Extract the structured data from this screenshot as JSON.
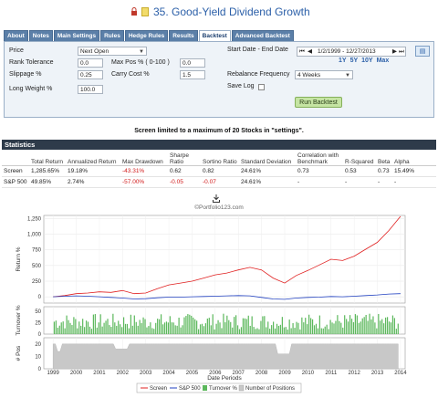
{
  "header": {
    "title": "35. Good-Yield Dividend Growth",
    "icons": [
      "lock-icon",
      "note-icon"
    ],
    "colors": {
      "title": "#2b5fa8",
      "lock": "#c0392b"
    }
  },
  "tabs": [
    {
      "label": "About",
      "active": false
    },
    {
      "label": "Notes",
      "active": false
    },
    {
      "label": "Main Settings",
      "active": false
    },
    {
      "label": "Rules",
      "active": false
    },
    {
      "label": "Hedge Rules",
      "active": false
    },
    {
      "label": "Results",
      "active": false
    },
    {
      "label": "Backtest",
      "active": true
    },
    {
      "label": "Advanced Backtest",
      "active": false
    }
  ],
  "form": {
    "price_label": "Price",
    "price_value": "Next Open",
    "rank_tolerance_label": "Rank Tolerance",
    "rank_tolerance_value": "0.0",
    "max_pos_label": "Max Pos % ( 0-100 )",
    "max_pos_value": "0.0",
    "slippage_label": "Slippage %",
    "slippage_value": "0.25",
    "carry_cost_label": "Carry Cost %",
    "carry_cost_value": "1.5",
    "long_weight_label": "Long Weight %",
    "long_weight_value": "100.0",
    "date_range_label": "Start Date - End Date",
    "date_range_value": "1/2/1999 - 12/27/2013",
    "periods": [
      "1Y",
      "5Y",
      "10Y",
      "Max"
    ],
    "rebalance_label": "Rebalance Frequency",
    "rebalance_value": "4 Weeks",
    "save_log_label": "Save Log",
    "save_log_checked": false,
    "run_button": "Run Backtest"
  },
  "notice": "Screen limited to a maximum of 20 Stocks in \"settings\".",
  "stats": {
    "heading": "Statistics",
    "columns": [
      "",
      "Total Return",
      "Annualized Return",
      "Max Drawdown",
      "Sharpe Ratio",
      "Sortino Ratio",
      "Standard Deviation",
      "Correlation with Benchmark",
      "R-Squared",
      "Beta",
      "Alpha"
    ],
    "rows": [
      [
        "Screen",
        "1,285.65%",
        "19.18%",
        "-43.31%",
        "0.62",
        "0.82",
        "24.61%",
        "0.73",
        "0.53",
        "0.73",
        "15.49%"
      ],
      [
        "S&P 500",
        "49.85%",
        "2.74%",
        "-57.00%",
        "-0.05",
        "-0.07",
        "24.61%",
        "-",
        "-",
        "-",
        "-"
      ]
    ]
  },
  "watermark": "©Portfolio123.com",
  "chart_data": {
    "type": "line",
    "title": "",
    "xlabel": "Date Periods",
    "ylabel": "Return %",
    "x_ticks": [
      "1999",
      "2000",
      "2001",
      "2002",
      "2003",
      "2004",
      "2005",
      "2006",
      "2007",
      "2008",
      "2009",
      "2010",
      "2011",
      "2012",
      "2013",
      "2014"
    ],
    "y_ticks": [
      "0",
      "250",
      "500",
      "750",
      "1,000",
      "1,250"
    ],
    "ylim": [
      -100,
      1300
    ],
    "series": [
      {
        "name": "Screen",
        "color": "#e02020",
        "x": [
          1999,
          1999.5,
          2000,
          2000.5,
          2001,
          2001.5,
          2002,
          2002.5,
          2003,
          2003.5,
          2004,
          2004.5,
          2005,
          2005.5,
          2006,
          2006.5,
          2007,
          2007.5,
          2008,
          2008.5,
          2009,
          2009.5,
          2010,
          2010.5,
          2011,
          2011.5,
          2012,
          2012.5,
          2013,
          2013.5,
          2014
        ],
        "values": [
          0,
          20,
          50,
          60,
          80,
          70,
          100,
          50,
          60,
          130,
          190,
          220,
          250,
          300,
          350,
          380,
          430,
          470,
          430,
          300,
          220,
          340,
          420,
          510,
          600,
          580,
          650,
          760,
          870,
          1060,
          1285
        ]
      },
      {
        "name": "S&P 500",
        "color": "#2040c0",
        "x": [
          1999,
          1999.5,
          2000,
          2000.5,
          2001,
          2001.5,
          2002,
          2002.5,
          2003,
          2003.5,
          2004,
          2004.5,
          2005,
          2005.5,
          2006,
          2006.5,
          2007,
          2007.5,
          2008,
          2008.5,
          2009,
          2009.5,
          2010,
          2010.5,
          2011,
          2011.5,
          2012,
          2012.5,
          2013,
          2013.5,
          2014
        ],
        "values": [
          0,
          10,
          15,
          10,
          0,
          -10,
          -20,
          -35,
          -30,
          -15,
          -5,
          -5,
          0,
          5,
          10,
          15,
          20,
          15,
          -10,
          -35,
          -40,
          -20,
          -10,
          -5,
          5,
          0,
          10,
          20,
          30,
          45,
          50
        ]
      }
    ],
    "turnover": {
      "name": "Turnover %",
      "color": "#5cb85c",
      "ylabel": "Turnover %",
      "y_ticks": [
        "0",
        "25",
        "50"
      ],
      "ylim": [
        0,
        60
      ]
    },
    "positions": {
      "name": "Number of Positions",
      "color": "#c8c8c8",
      "ylabel": "# Pos",
      "y_ticks": [
        "0",
        "10",
        "20"
      ],
      "ylim": [
        0,
        25
      ]
    },
    "legend": [
      "Screen",
      "S&P 500",
      "Turnover %",
      "Number of Positions"
    ],
    "legend_position": "bottom"
  }
}
